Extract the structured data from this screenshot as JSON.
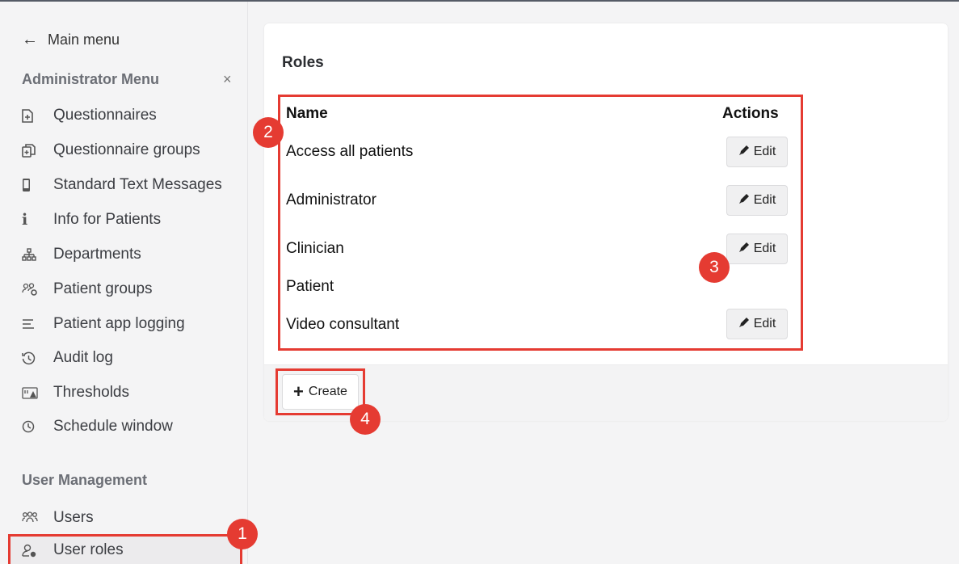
{
  "sidebar": {
    "main_menu": "Main menu",
    "admin_heading": "Administrator Menu",
    "close_symbol": "×",
    "admin_items": [
      {
        "label": "Questionnaires",
        "icon": "file-plus-icon"
      },
      {
        "label": "Questionnaire groups",
        "icon": "copy-files-icon"
      },
      {
        "label": "Standard Text Messages",
        "icon": "phone-icon"
      },
      {
        "label": "Info for Patients",
        "icon": "info-icon"
      },
      {
        "label": "Departments",
        "icon": "hierarchy-icon"
      },
      {
        "label": "Patient groups",
        "icon": "people-group-icon"
      },
      {
        "label": "Patient app logging",
        "icon": "lines-icon"
      },
      {
        "label": "Audit log",
        "icon": "history-icon"
      },
      {
        "label": "Thresholds",
        "icon": "threshold-warning-icon"
      },
      {
        "label": "Schedule window",
        "icon": "clock-icon"
      }
    ],
    "user_mgmt_heading": "User Management",
    "user_items": [
      {
        "label": "Users",
        "icon": "users-icon"
      },
      {
        "label": "User roles",
        "icon": "user-role-icon",
        "active": true
      }
    ]
  },
  "main": {
    "title": "Roles",
    "columns": {
      "name": "Name",
      "actions": "Actions"
    },
    "edit_label": "Edit",
    "create_label": "Create",
    "roles": [
      {
        "name": "Access all patients",
        "editable": true
      },
      {
        "name": "Administrator",
        "editable": true
      },
      {
        "name": "Clinician",
        "editable": true
      },
      {
        "name": "Patient",
        "editable": false
      },
      {
        "name": "Video consultant",
        "editable": true
      }
    ]
  },
  "annotations": [
    "1",
    "2",
    "3",
    "4"
  ],
  "colors": {
    "highlight": "#e53b32",
    "sidebar_bg": "#f4f4f5",
    "card_bg": "#ffffff"
  }
}
